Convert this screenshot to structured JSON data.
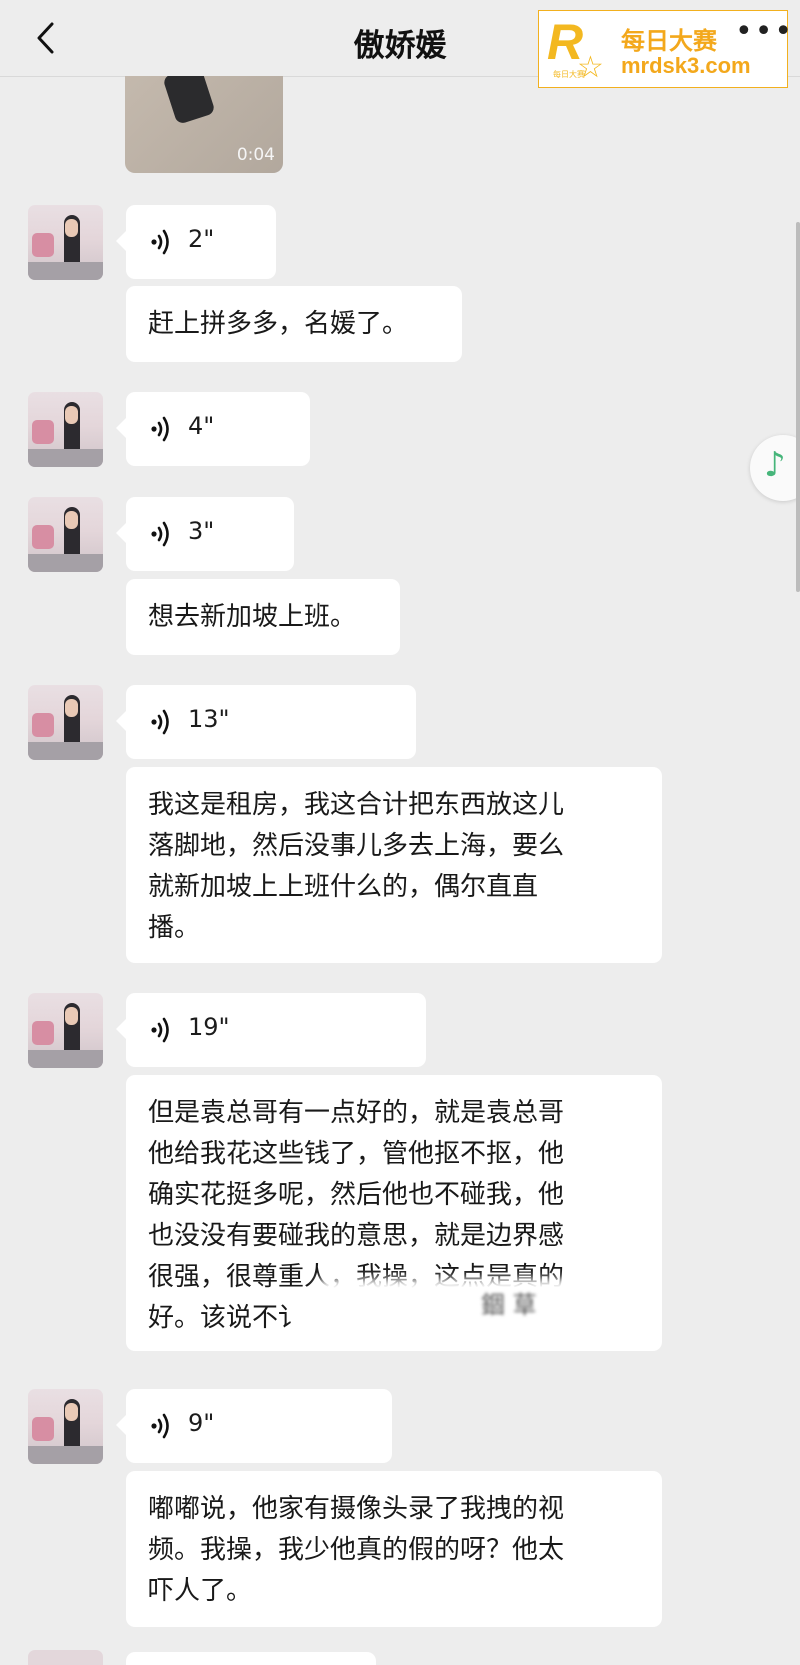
{
  "header": {
    "title": "傲娇媛"
  },
  "watermark": {
    "logo_letter": "R",
    "logo_small": "每日大赛",
    "name": "每日大赛",
    "url": "mrdsk3.com",
    "more": "•••"
  },
  "video": {
    "duration": "0:04"
  },
  "messages": [
    {
      "type": "voice",
      "length": "2\""
    },
    {
      "type": "text",
      "text": "赶上拼多多，名媛了。"
    },
    {
      "type": "voice",
      "length": "4\""
    },
    {
      "type": "voice",
      "length": "3\""
    },
    {
      "type": "text",
      "text": "想去新加坡上班。"
    },
    {
      "type": "voice",
      "length": "13\""
    },
    {
      "type": "text",
      "text": "我这是租房，我这合计把东西放这儿\n落脚地，然后没事儿多去上海，要么\n就新加坡上上班什么的，偶尔直直\n播。"
    },
    {
      "type": "voice",
      "length": "19\""
    },
    {
      "type": "text",
      "text": "但是袁总哥有一点好的，就是袁总哥\n他给我花这些钱了，管他抠不抠，他\n确实花挺多呢，然后他也不碰我，他\n也没没有要碰我的意思，就是边界感\n很强，很尊重人，我操，这点是真的\n好。该说不讠",
      "blurred_tail": "錮 䓍"
    },
    {
      "type": "voice",
      "length": "9\""
    },
    {
      "type": "text",
      "text": "嘟嘟说，他家有摄像头录了我拽的视\n频。我操，我少他真的假的呀？他太\n吓人了。"
    }
  ],
  "floating": {
    "icon": "music-note-icon",
    "glyph": "♪",
    "color": "#46b57a"
  },
  "colors": {
    "background": "#ededed",
    "bubble": "#ffffff",
    "watermark": "#f3b820"
  }
}
